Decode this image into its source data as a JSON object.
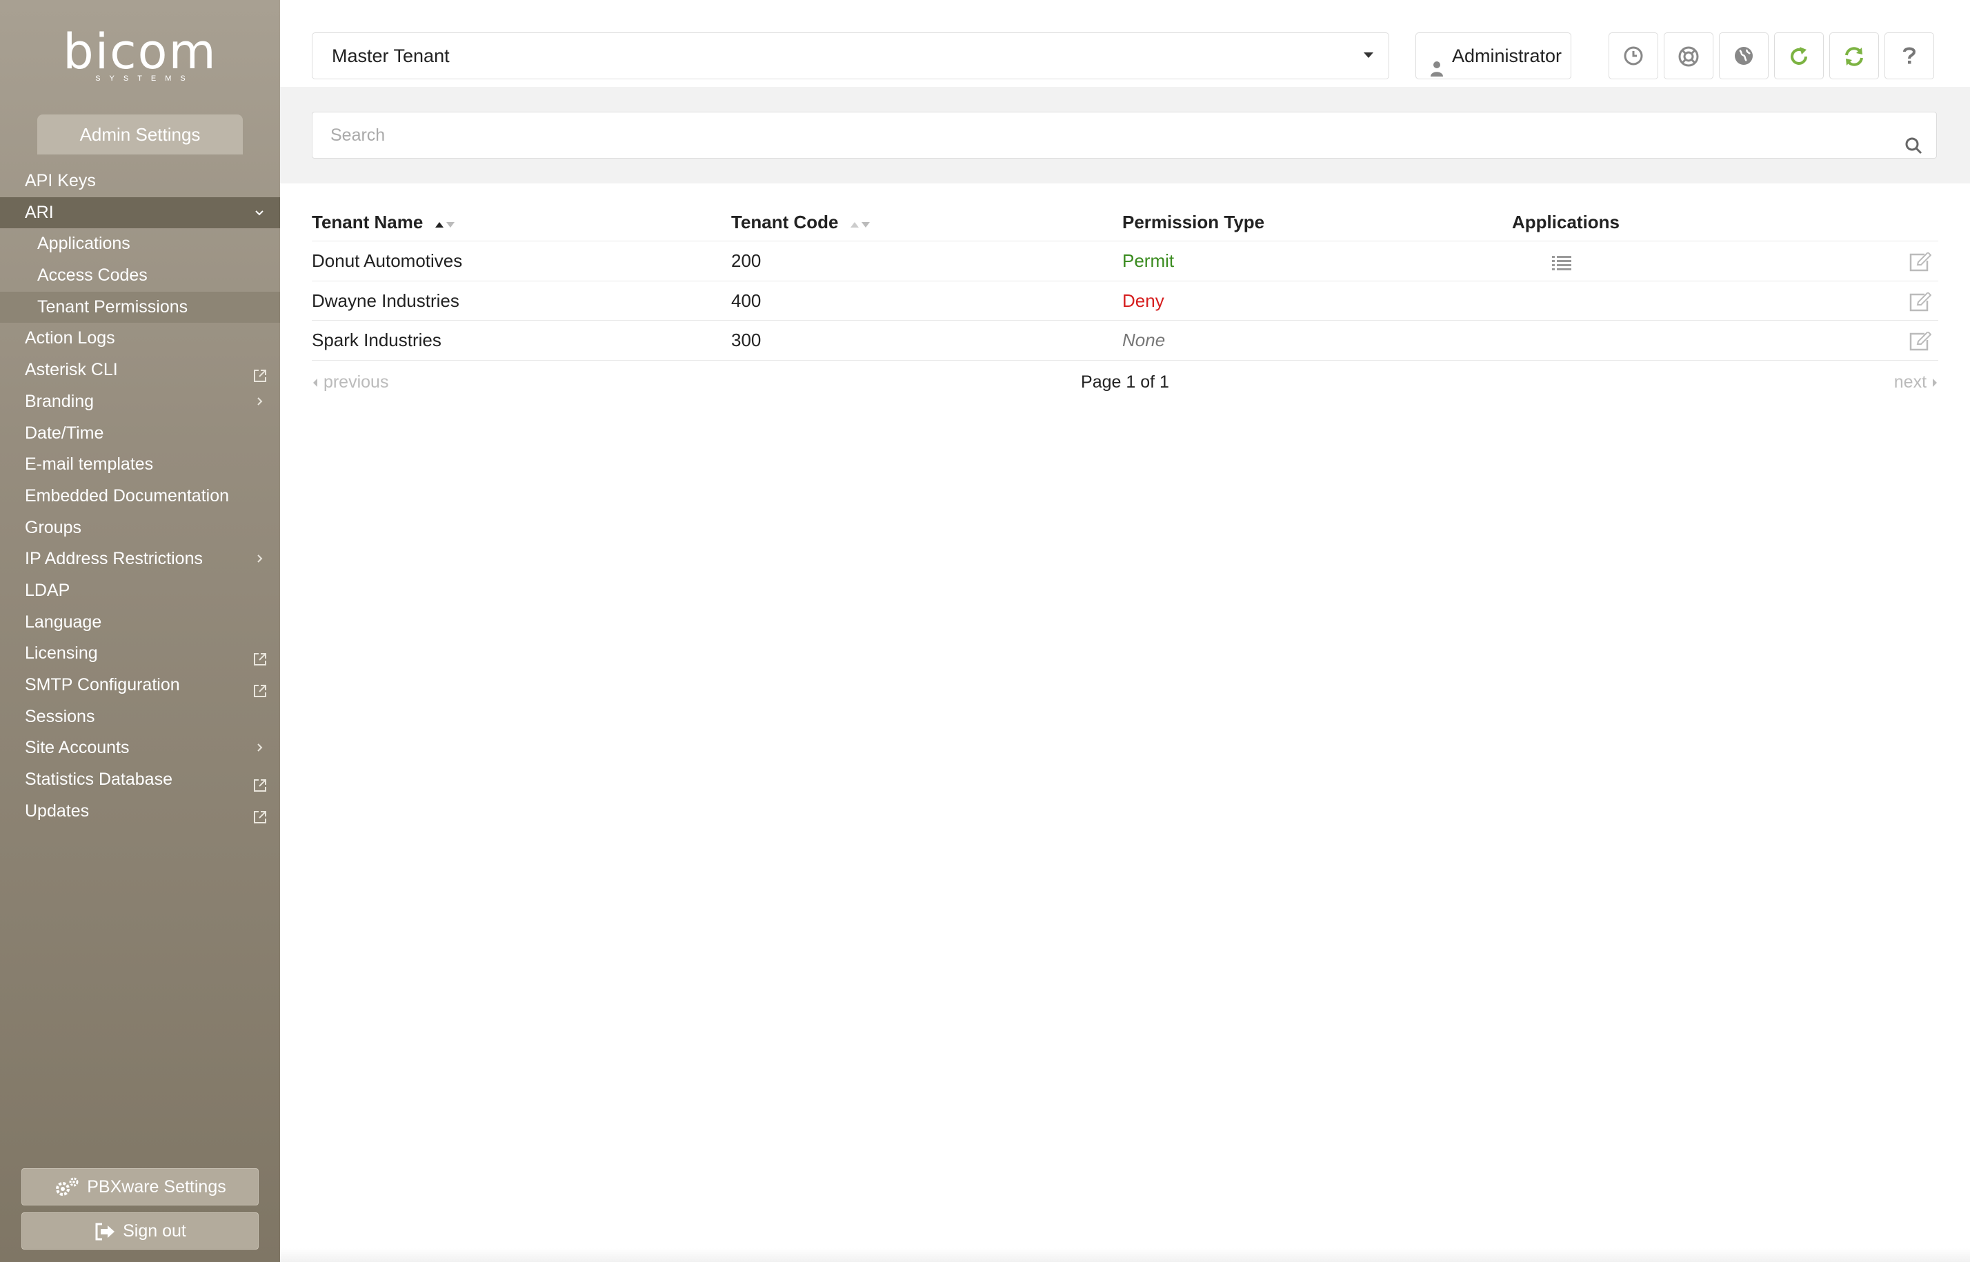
{
  "brand": {
    "logo_word": "bicom",
    "logo_sub": "SYSTEMS"
  },
  "sidebar": {
    "section_title": "Admin Settings",
    "items": [
      {
        "label": "API Keys"
      },
      {
        "label": "ARI",
        "expanded": true
      },
      {
        "label": "Applications",
        "sub": true
      },
      {
        "label": "Access Codes",
        "sub": true
      },
      {
        "label": "Tenant Permissions",
        "sub": true,
        "selected": true
      },
      {
        "label": "Action Logs"
      },
      {
        "label": "Asterisk CLI",
        "external": true
      },
      {
        "label": "Branding",
        "has_children": true
      },
      {
        "label": "Date/Time"
      },
      {
        "label": "E-mail templates"
      },
      {
        "label": "Embedded Documentation"
      },
      {
        "label": "Groups"
      },
      {
        "label": "IP Address Restrictions",
        "has_children": true
      },
      {
        "label": "LDAP"
      },
      {
        "label": "Language"
      },
      {
        "label": "Licensing",
        "external": true
      },
      {
        "label": "SMTP Configuration",
        "external": true
      },
      {
        "label": "Sessions"
      },
      {
        "label": "Site Accounts",
        "has_children": true
      },
      {
        "label": "Statistics Database",
        "external": true
      },
      {
        "label": "Updates",
        "external": true
      }
    ],
    "pbxware_settings_label": "PBXware Settings",
    "sign_out_label": "Sign out"
  },
  "topbar": {
    "tenant_selected": "Master Tenant",
    "user_label": "Administrator",
    "icons": [
      "clock-icon",
      "lifebuoy-icon",
      "globe-icon",
      "reload-icon",
      "sync-icon",
      "help-icon"
    ]
  },
  "search": {
    "placeholder": "Search"
  },
  "table": {
    "columns": [
      "Tenant Name",
      "Tenant Code",
      "Permission Type",
      "Applications"
    ],
    "rows": [
      {
        "name": "Donut Automotives",
        "code": "200",
        "permission": "Permit",
        "has_applications": true
      },
      {
        "name": "Dwayne Industries",
        "code": "400",
        "permission": "Deny",
        "has_applications": false
      },
      {
        "name": "Spark Industries",
        "code": "300",
        "permission": "None",
        "has_applications": false
      }
    ]
  },
  "pagination": {
    "prev_label": "previous",
    "page_label": "Page 1 of 1",
    "next_label": "next"
  },
  "colors": {
    "permit": "#3a8b1f",
    "deny": "#d61f1f",
    "none": "#777777",
    "accent_green": "#7cb342"
  }
}
